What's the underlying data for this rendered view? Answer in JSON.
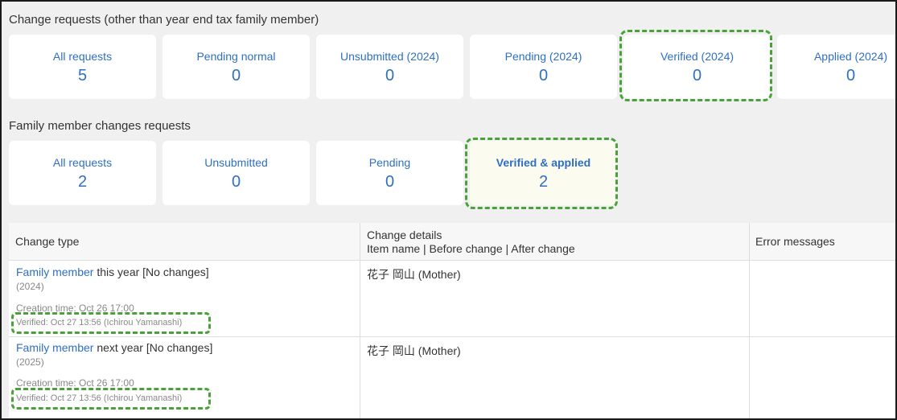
{
  "change_requests": {
    "title": "Change requests (other than year end tax family member)",
    "cards": [
      {
        "label": "All requests",
        "value": "5"
      },
      {
        "label": "Pending normal",
        "value": "0"
      },
      {
        "label": "Unsubmitted (2024)",
        "value": "0"
      },
      {
        "label": "Pending (2024)",
        "value": "0"
      },
      {
        "label": "Verified (2024)",
        "value": "0"
      },
      {
        "label": "Applied (2024)",
        "value": "0"
      }
    ]
  },
  "family_requests": {
    "title": "Family member changes requests",
    "cards": [
      {
        "label": "All requests",
        "value": "2"
      },
      {
        "label": "Unsubmitted",
        "value": "0"
      },
      {
        "label": "Pending",
        "value": "0"
      },
      {
        "label": "Verified & applied",
        "value": "2"
      }
    ]
  },
  "table": {
    "headers": {
      "change_type": "Change type",
      "change_details_line1": "Change details",
      "change_details_line2": "Item name | Before change | After change",
      "error_messages": "Error messages"
    },
    "rows": [
      {
        "link": "Family member",
        "type_text": " this year  [No changes]",
        "year": "(2024)",
        "creation": "Creation time: Oct 26 17:00",
        "verified": "Verified: Oct 27 13:56 (Ichirou Yamanashi)",
        "details": "花子 岡山 (Mother)"
      },
      {
        "link": "Family member",
        "type_text": " next year  [No changes]",
        "year": "(2025)",
        "creation": "Creation time: Oct 26 17:00",
        "verified": "Verified: Oct 27 13:56 (Ichirou Yamanashi)",
        "details": "花子 岡山 (Mother)"
      }
    ]
  },
  "colors": {
    "link": "#2e6fc4",
    "highlight_dash": "#4aa13a",
    "background": "#f0f0f0"
  }
}
